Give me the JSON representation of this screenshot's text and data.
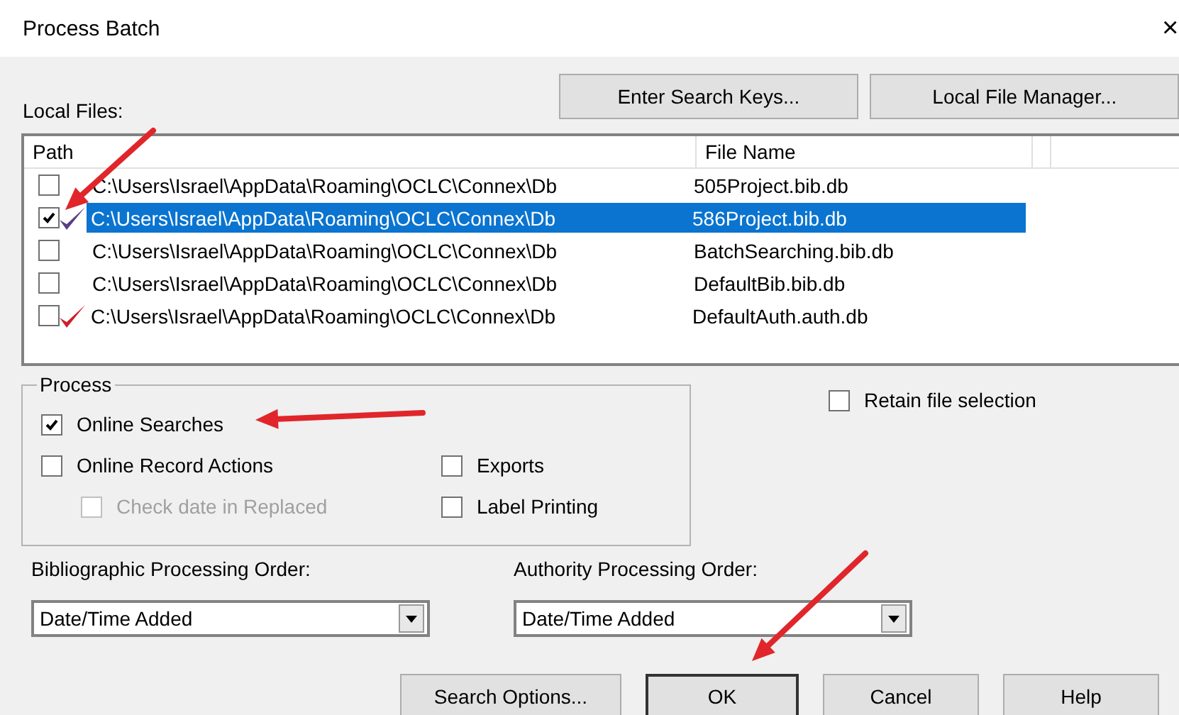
{
  "window": {
    "title": "Process Batch",
    "close": "×"
  },
  "top_buttons": [
    "Enter Search Keys...",
    "Local File Manager..."
  ],
  "local_files": {
    "label": "Local Files:",
    "columns": [
      "Path",
      "File Name"
    ],
    "rows": [
      {
        "path": "C:\\Users\\Israel\\AppData\\Roaming\\OCLC\\Connex\\Db",
        "file": "505Project.bib.db",
        "checked": false,
        "selected": false
      },
      {
        "path": "C:\\Users\\Israel\\AppData\\Roaming\\OCLC\\Connex\\Db",
        "file": "586Project.bib.db",
        "checked": true,
        "selected": true,
        "color": "#5a3d86"
      },
      {
        "path": "C:\\Users\\Israel\\AppData\\Roaming\\OCLC\\Connex\\Db",
        "file": "BatchSearching.bib.db",
        "checked": false,
        "selected": false
      },
      {
        "path": "C:\\Users\\Israel\\AppData\\Roaming\\OCLC\\Connex\\Db",
        "file": "DefaultBib.bib.db",
        "checked": false,
        "selected": false
      },
      {
        "path": "C:\\Users\\Israel\\AppData\\Roaming\\OCLC\\Connex\\Db",
        "file": "DefaultAuth.auth.db",
        "checked": false,
        "selected": false,
        "color": "#d0202a"
      }
    ]
  },
  "process": {
    "label": "Process",
    "left": [
      {
        "label": "Online Searches",
        "checked": true,
        "disabled": false,
        "kind": "option"
      },
      {
        "label": "Online Record Actions",
        "checked": false,
        "disabled": false,
        "kind": "option"
      },
      {
        "label": "Check date in Replaced",
        "checked": false,
        "disabled": true,
        "kind": "suboption"
      }
    ],
    "right": [
      {
        "label": "Exports",
        "checked": false,
        "disabled": false
      },
      {
        "label": "Label Printing",
        "checked": false,
        "disabled": false
      }
    ]
  },
  "retain": {
    "label": "Retain file selection",
    "checked": false
  },
  "orders": [
    {
      "label": "Bibliographic Processing Order:",
      "value": "Date/Time Added"
    },
    {
      "label": "Authority Processing Order:",
      "value": "Date/Time Added"
    }
  ],
  "bottom_buttons": [
    {
      "label": "Search Options...",
      "default": false
    },
    {
      "label": "OK",
      "default": true
    },
    {
      "label": "Cancel",
      "default": false
    },
    {
      "label": "Help",
      "default": false
    }
  ]
}
